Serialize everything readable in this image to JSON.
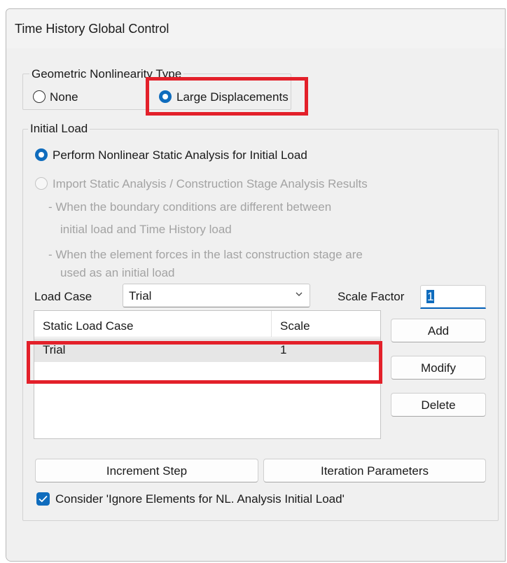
{
  "window": {
    "title": "Time History Global Control"
  },
  "geometric_nonlinearity": {
    "legend": "Geometric Nonlinearity Type",
    "options": [
      {
        "label": "None",
        "selected": false
      },
      {
        "label": "Large Displacements",
        "selected": true
      }
    ]
  },
  "initial_load": {
    "legend": "Initial Load",
    "option_static": {
      "label": "Perform Nonlinear Static Analysis for Initial Load",
      "selected": true
    },
    "option_import": {
      "label": "Import Static Analysis / Construction Stage Analysis Results",
      "selected": false,
      "enabled": false
    },
    "notes": [
      "- When the boundary conditions are different between",
      "initial load and Time History load",
      "- When the element forces in the last construction stage are",
      "used as an initial load"
    ],
    "load_case_label": "Load Case",
    "load_case_value": "Trial",
    "scale_factor_label": "Scale Factor",
    "scale_factor_value": "1",
    "table": {
      "columns": [
        "Static Load Case",
        "Scale"
      ],
      "rows": [
        {
          "load_case": "Trial",
          "scale": "1"
        }
      ]
    },
    "buttons": {
      "add": "Add",
      "modify": "Modify",
      "delete": "Delete"
    },
    "increment_step": "Increment Step",
    "iteration_parameters": "Iteration Parameters",
    "ignore_elements": {
      "label": "Consider 'Ignore Elements for NL. Analysis Initial Load'",
      "checked": true
    }
  },
  "colors": {
    "accent": "#0f6cbd",
    "highlight": "#e3202a"
  }
}
